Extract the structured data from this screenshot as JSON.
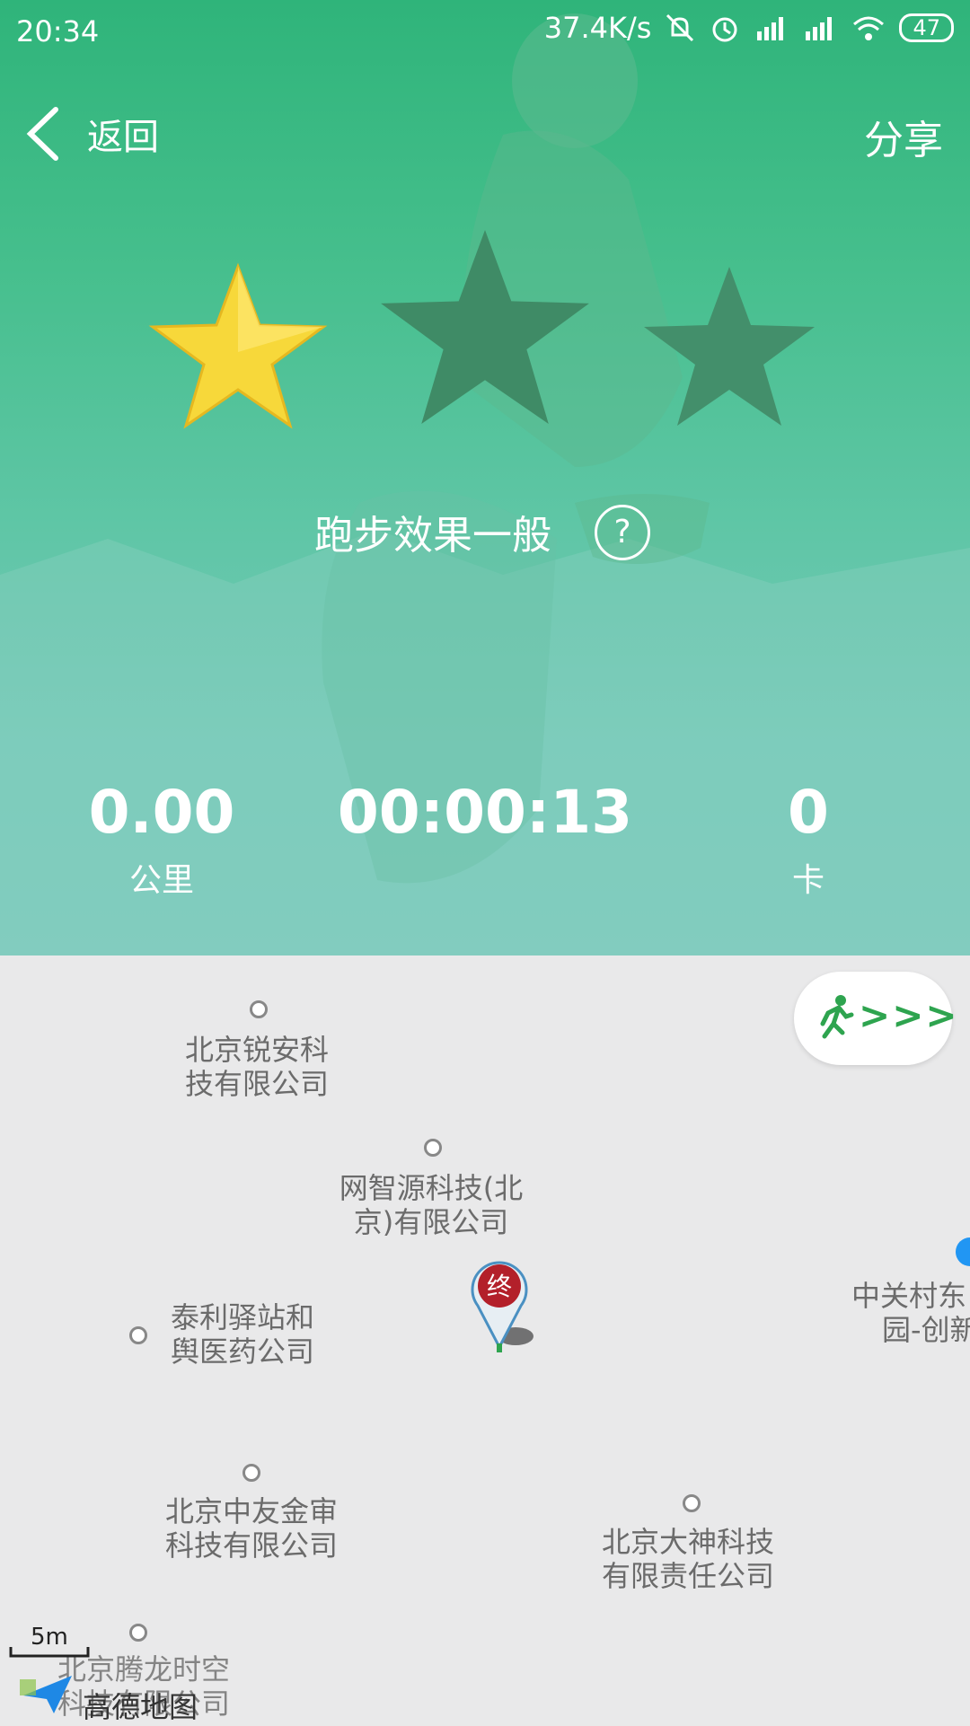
{
  "status_bar": {
    "time": "20:34",
    "speed": "37.4K/s",
    "battery": "47",
    "icons": [
      "mute-icon",
      "alarm-icon",
      "hd-signal-icon",
      "signal-icon",
      "wifi-icon",
      "battery-icon"
    ]
  },
  "topbar": {
    "back_label": "返回",
    "share_label": "分享"
  },
  "rating": {
    "stars_filled": 1,
    "stars_total": 3,
    "text": "跑步效果一般"
  },
  "stats": {
    "distance": {
      "value": "0.00",
      "unit": "公里"
    },
    "duration": {
      "value": "00:00:13"
    },
    "calories": {
      "value": "0",
      "unit": "卡"
    }
  },
  "map": {
    "run_button_arrows": ">>>",
    "end_marker_label": "终",
    "pois": [
      {
        "line1": "北京锐安科",
        "line2": "技有限公司"
      },
      {
        "line1": "网智源科技(北",
        "line2": "京)有限公司"
      },
      {
        "line1": "泰利驿站和",
        "line2": "舆医药公司"
      },
      {
        "line1": "北京中友金审",
        "line2": "科技有限公司"
      },
      {
        "line1": "北京大神科技",
        "line2": "有限责任公司"
      },
      {
        "line1": "中关村东",
        "line2": "园-创新"
      },
      {
        "line1": "北京腾龙时空",
        "line2": "科技有限公司"
      }
    ],
    "scale": "5m",
    "logo": "高德地图"
  },
  "colors": {
    "hero_top": "#2fb47a",
    "hero_bottom": "#7bc9bd",
    "star_gold": "#f7d83a",
    "star_dark": "#3f8b66",
    "run_green": "#2ea44f"
  }
}
